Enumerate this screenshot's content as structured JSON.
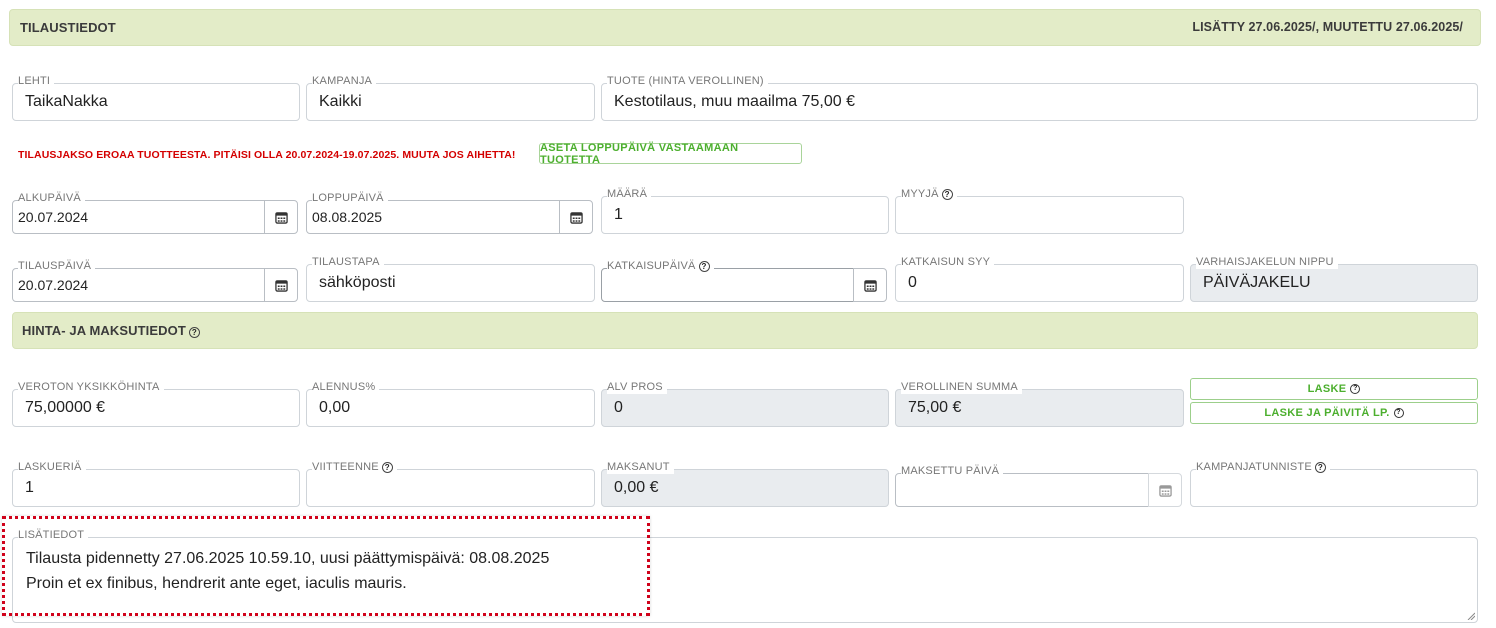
{
  "order_section": {
    "title": "TILAUSTIEDOT",
    "meta": "LISÄTTY 27.06.2025/, MUUTETTU 27.06.2025/"
  },
  "fields": {
    "lehti": {
      "label": "LEHTI",
      "value": "TaikaNakka"
    },
    "kampanja": {
      "label": "KAMPANJA",
      "value": "Kaikki"
    },
    "tuote": {
      "label": "TUOTE (HINTA VEROLLINEN)",
      "value": "Kestotilaus, muu maailma 75,00 €"
    },
    "alkupaiva": {
      "label": "ALKUPÄIVÄ",
      "value": "20.07.2024"
    },
    "loppupaiva": {
      "label": "LOPPUPÄIVÄ",
      "value": "08.08.2025"
    },
    "maara": {
      "label": "MÄÄRÄ",
      "value": "1"
    },
    "myyja": {
      "label": "MYYJÄ",
      "value": ""
    },
    "tilauspaiva": {
      "label": "TILAUSPÄIVÄ",
      "value": "20.07.2024"
    },
    "tilaustapa": {
      "label": "TILAUSTAPA",
      "value": "sähköposti"
    },
    "katkaisupaiva": {
      "label": "KATKAISUPÄIVÄ",
      "value": ""
    },
    "katkaisun_syy": {
      "label": "KATKAISUN SYY",
      "value": "0"
    },
    "varhaisjakelun_nippu": {
      "label": "VARHAISJAKELUN NIPPU",
      "value": "PÄIVÄJAKELU"
    }
  },
  "warning": {
    "text": "TILAUSJAKSO EROAA TUOTTEESTA. PITÄISI OLLA 20.07.2024-19.07.2025. MUUTA JOS AIHETTA!",
    "button_label": "ASETA LOPPUPÄIVÄ VASTAAMAAN TUOTETTA"
  },
  "price_section": {
    "title": "HINTA- JA MAKSUTIEDOT"
  },
  "price_fields": {
    "veroton": {
      "label": "VEROTON YKSIKKÖHINTA",
      "value": "75,00000 €"
    },
    "alennus": {
      "label": "ALENNUS%",
      "value": "0,00"
    },
    "alv": {
      "label": "ALV PROS",
      "value": "0"
    },
    "verollinen": {
      "label": "VEROLLINEN SUMMA",
      "value": "75,00 €"
    },
    "laskueria": {
      "label": "LASKUERIÄ",
      "value": "1"
    },
    "viitteenne": {
      "label": "VIITTEENNE",
      "value": ""
    },
    "maksanut": {
      "label": "MAKSANUT",
      "value": "0,00 €"
    },
    "maksettu_paiva": {
      "label": "MAKSETTU PÄIVÄ",
      "value": ""
    },
    "kampanjatunniste": {
      "label": "KAMPANJATUNNISTE",
      "value": ""
    }
  },
  "buttons": {
    "laske": "LASKE",
    "laske_paivita": "LASKE JA PÄIVITÄ LP."
  },
  "lisatiedot": {
    "label": "LISÄTIEDOT",
    "line1": "Tilausta pidennetty 27.06.2025 10.59.10, uusi päättymispäivä: 08.08.2025",
    "line2": "Proin et ex finibus, hendrerit ante eget, iaculis mauris."
  },
  "help_icon_glyph": "?"
}
